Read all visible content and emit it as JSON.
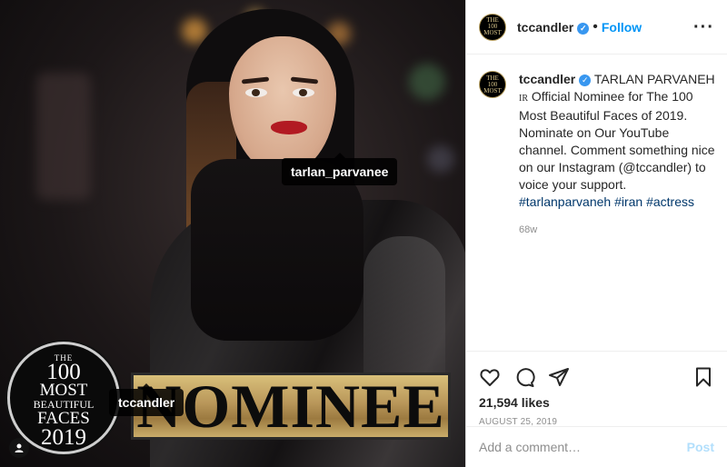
{
  "photo": {
    "tags": [
      "tarlan_parvanee",
      "tccandler"
    ],
    "badge": {
      "line1": "THE",
      "line2": "100",
      "line3": "MOST",
      "line4": "BEAUTIFUL",
      "line5": "FACES",
      "line6": "2019"
    },
    "banner": "NOMINEE"
  },
  "header": {
    "username": "tccandler",
    "follow_label": "Follow",
    "more_icon": "more-horizontal-icon"
  },
  "caption": {
    "username": "tccandler",
    "name": "TARLAN PARVANEH",
    "country_code": "IR",
    "text": "Official Nominee for The 100 Most Beautiful Faces of 2019. Nominate on Our YouTube channel. Comment something nice on our Instagram (@tccandler) to voice your support.",
    "hashtags": "#tarlanparvaneh #iran #actress",
    "age": "68w"
  },
  "actions": {
    "icons": [
      "heart-icon",
      "comment-icon",
      "share-icon",
      "bookmark-icon"
    ],
    "likes": "21,594 likes",
    "date": "AUGUST 25, 2019"
  },
  "comment": {
    "placeholder": "Add a comment…",
    "post_label": "Post"
  },
  "colors": {
    "accent": "#0095f6",
    "verified": "#3897f0",
    "post_disabled": "#b2dffc",
    "gold": "#c9ad6a"
  }
}
